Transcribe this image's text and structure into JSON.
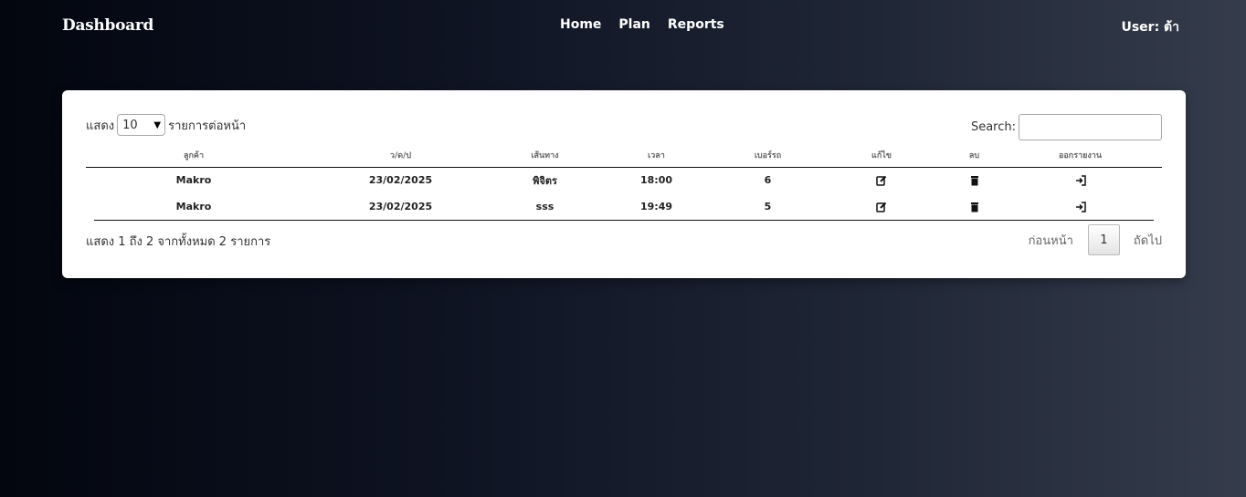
{
  "navbar": {
    "brand": "Dashboard",
    "links": [
      "Home",
      "Plan",
      "Reports"
    ],
    "user": "User: ต้า"
  },
  "table_controls": {
    "length_prefix": "แสดง",
    "length_value": "10",
    "length_suffix": "รายการต่อหน้า",
    "search_label": "Search:",
    "search_value": ""
  },
  "table": {
    "headers": [
      "ลูกค้า",
      "ว/ด/ป",
      "เส้นทาง",
      "เวลา",
      "เบอร์รถ",
      "แก้ไข",
      "ลบ",
      "ออกรายงาน"
    ],
    "rows": [
      {
        "customer": "Makro",
        "date": "23/02/2025",
        "route": "พิจิตร",
        "time": "18:00",
        "truck": "6"
      },
      {
        "customer": "Makro",
        "date": "23/02/2025",
        "route": "sss",
        "time": "19:49",
        "truck": "5"
      }
    ],
    "icons": {
      "edit": "edit-icon",
      "delete": "trash-icon",
      "report": "sign-in-icon"
    }
  },
  "footer": {
    "info": "แสดง 1 ถึง 2 จากทั้งหมด 2 รายการ",
    "prev": "ก่อนหน้า",
    "current_page": "1",
    "next": "ถัดไป"
  }
}
